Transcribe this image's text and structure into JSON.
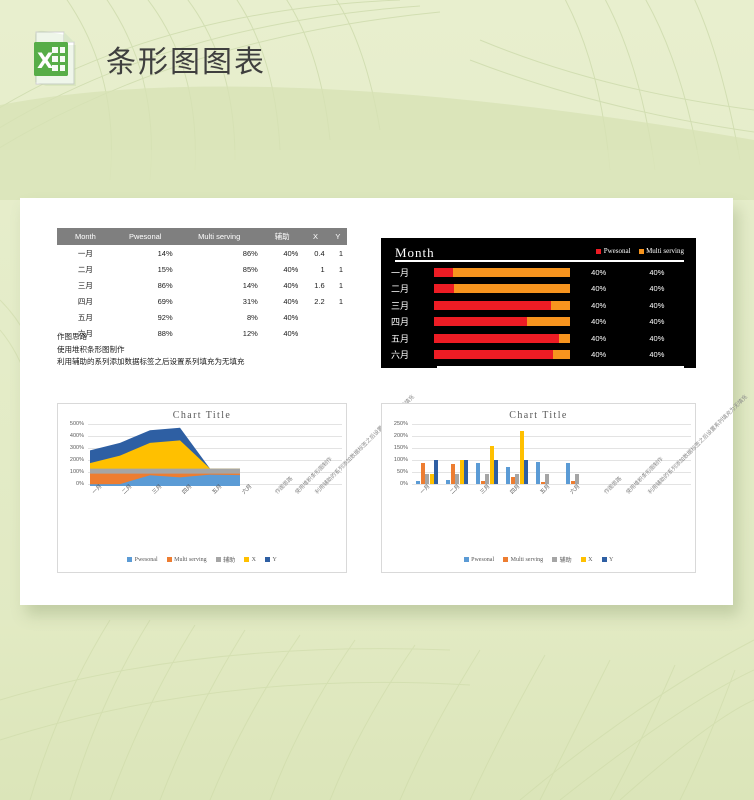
{
  "header": {
    "title": "条形图图表",
    "icon": "excel-icon"
  },
  "table": {
    "columns": [
      "Month",
      "Pwesonal",
      "Multi serving",
      "辅助",
      "X",
      "Y"
    ],
    "rows": [
      [
        "一月",
        "14%",
        "86%",
        "40%",
        "0.4",
        "1"
      ],
      [
        "二月",
        "15%",
        "85%",
        "40%",
        "1",
        "1"
      ],
      [
        "三月",
        "86%",
        "14%",
        "40%",
        "1.6",
        "1"
      ],
      [
        "四月",
        "69%",
        "31%",
        "40%",
        "2.2",
        "1"
      ],
      [
        "五月",
        "92%",
        "8%",
        "40%",
        "",
        ""
      ],
      [
        "六月",
        "88%",
        "12%",
        "40%",
        "",
        ""
      ]
    ]
  },
  "notes": [
    "作图思路",
    "使用堆积条形图制作",
    "利用辅助的系列添加数据标签之后设置系列填充为无填充"
  ],
  "colors": {
    "series_pwesonal": "#4a90d9",
    "series_multi": "#ED7D31",
    "series_aux": "#A5A5A5",
    "series_x": "#FFC000",
    "series_y": "#2E5FA3",
    "bar_red": "#ED1C24",
    "bar_orange": "#F7941E",
    "dark_bg": "#000000",
    "table_header": "#7F7F7F",
    "page_bg": "#E4ECC8"
  },
  "chart_data": [
    {
      "type": "bar",
      "title": "Month",
      "orientation": "horizontal",
      "stacked": true,
      "theme": "dark",
      "categories": [
        "一月",
        "二月",
        "三月",
        "四月",
        "五月",
        "六月"
      ],
      "legend": [
        "Pwesonal",
        "Multi serving"
      ],
      "legend_position": "top-right",
      "series": [
        {
          "name": "Pwesonal",
          "color": "#ED1C24",
          "values": [
            14,
            15,
            86,
            69,
            92,
            88
          ]
        },
        {
          "name": "Multi serving",
          "color": "#F7941E",
          "values": [
            86,
            85,
            14,
            31,
            8,
            12
          ]
        }
      ],
      "data_labels": [
        [
          "40%",
          "40%"
        ],
        [
          "40%",
          "40%"
        ],
        [
          "40%",
          "40%"
        ],
        [
          "40%",
          "40%"
        ],
        [
          "40%",
          "40%"
        ],
        [
          "40%",
          "40%"
        ]
      ],
      "grid": false
    },
    {
      "type": "area",
      "title": "Chart Title",
      "stacked": true,
      "categories": [
        "一月",
        "二月",
        "三月",
        "四月",
        "五月",
        "六月"
      ],
      "annotations": [
        "作图思路",
        "使用堆积条形图制作",
        "利用辅助的系列添加数据标签之后设置系列填充为无填充"
      ],
      "ylabel": "",
      "xlabel": "",
      "ylim": [
        0,
        500
      ],
      "yticks": [
        "0%",
        "100%",
        "200%",
        "300%",
        "400%",
        "500%"
      ],
      "grid": true,
      "legend": [
        "Pwesonal",
        "Multi serving",
        "辅助",
        "X",
        "Y"
      ],
      "legend_position": "bottom",
      "series": [
        {
          "name": "Pwesonal",
          "color": "#4a90d9",
          "values": [
            14,
            15,
            86,
            69,
            92,
            88
          ]
        },
        {
          "name": "Multi serving",
          "color": "#ED7D31",
          "values": [
            86,
            85,
            14,
            31,
            8,
            12
          ]
        },
        {
          "name": "辅助",
          "color": "#A5A5A5",
          "values": [
            40,
            40,
            40,
            40,
            40,
            40
          ]
        },
        {
          "name": "X",
          "color": "#FFC000",
          "values": [
            40,
            100,
            160,
            220,
            0,
            0
          ]
        },
        {
          "name": "Y",
          "color": "#2E5FA3",
          "values": [
            100,
            100,
            100,
            100,
            0,
            0
          ]
        }
      ]
    },
    {
      "type": "bar",
      "title": "Chart Title",
      "stacked": false,
      "categories": [
        "一月",
        "二月",
        "三月",
        "四月",
        "五月",
        "六月"
      ],
      "annotations": [
        "作图思路",
        "使用堆积条形图制作",
        "利用辅助的系列添加数据标签之后设置系列填充为无填充"
      ],
      "ylabel": "",
      "xlabel": "",
      "ylim": [
        0,
        250
      ],
      "yticks": [
        "0%",
        "50%",
        "100%",
        "150%",
        "200%",
        "250%"
      ],
      "grid": true,
      "legend": [
        "Pwesonal",
        "Multi serving",
        "辅助",
        "X",
        "Y"
      ],
      "legend_position": "bottom",
      "series": [
        {
          "name": "Pwesonal",
          "color": "#4a90d9",
          "values": [
            14,
            15,
            86,
            69,
            92,
            88
          ]
        },
        {
          "name": "Multi serving",
          "color": "#ED7D31",
          "values": [
            86,
            85,
            14,
            31,
            8,
            12
          ]
        },
        {
          "name": "辅助",
          "color": "#A5A5A5",
          "values": [
            40,
            40,
            40,
            40,
            40,
            40
          ]
        },
        {
          "name": "X",
          "color": "#FFC000",
          "values": [
            40,
            100,
            160,
            220,
            0,
            0
          ]
        },
        {
          "name": "Y",
          "color": "#2E5FA3",
          "values": [
            100,
            100,
            100,
            100,
            0,
            0
          ]
        }
      ]
    }
  ]
}
